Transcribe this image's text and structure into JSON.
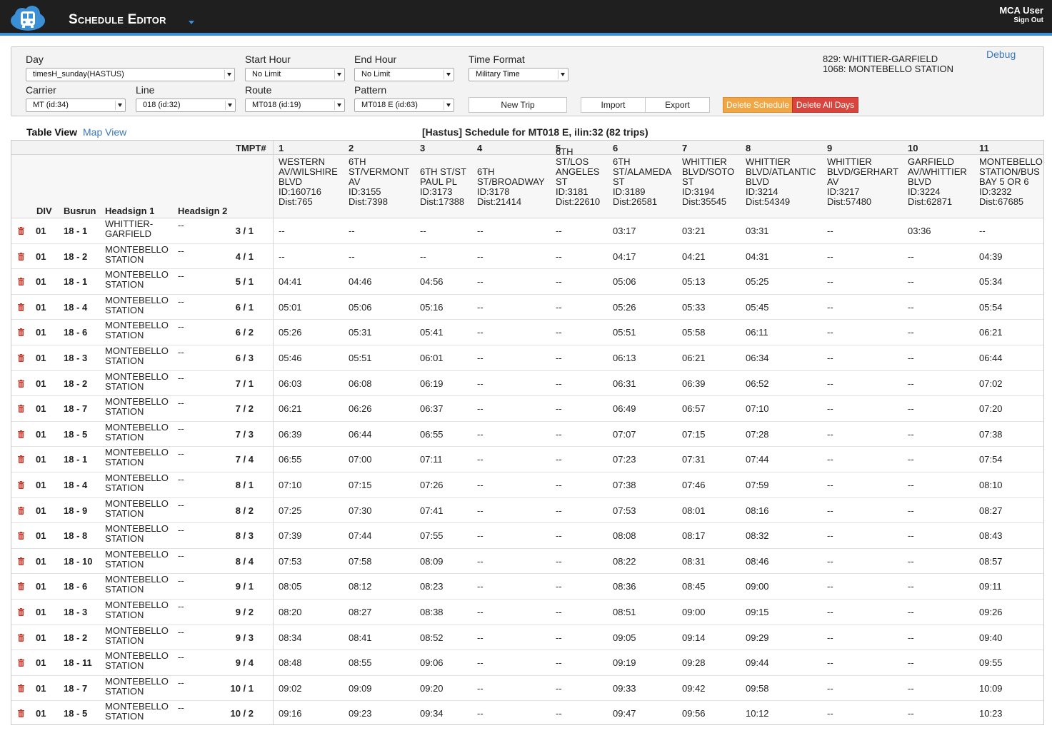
{
  "header": {
    "title": "Schedule Editor",
    "user": "MCA User",
    "sign_out": "Sign Out",
    "logo_icon": "bus-cloud-icon",
    "accent_color": "#3b8fd6"
  },
  "controls": {
    "day_label": "Day",
    "day_value": "timesH_sunday(HASTUS)",
    "start_hour_label": "Start Hour",
    "start_hour_value": "No Limit",
    "end_hour_label": "End Hour",
    "end_hour_value": "No Limit",
    "time_format_label": "Time Format",
    "time_format_value": "Military Time",
    "carrier_label": "Carrier",
    "carrier_value": "MT (id:34)",
    "line_label": "Line",
    "line_value": "018 (id:32)",
    "route_label": "Route",
    "route_value": "MT018 (id:19)",
    "pattern_label": "Pattern",
    "pattern_value": "MT018 E (id:63)",
    "new_trip": "New Trip",
    "import": "Import",
    "export": "Export",
    "delete_schedule": "Delete Schedule",
    "delete_all_days": "Delete All Days",
    "info_line1": "829: WHITTIER-GARFIELD",
    "info_line2": "1068: MONTEBELLO STATION",
    "debug": "Debug"
  },
  "view": {
    "table_view": "Table View",
    "map_view": "Map View",
    "schedule_title": "[Hastus] Schedule for MT018 E, ilin:32 (82 trips)"
  },
  "table": {
    "tmpt_label": "TMPT#",
    "col_div": "DIV",
    "col_busrun": "Busrun",
    "col_headsign1": "Headsign 1",
    "col_headsign2": "Headsign 2",
    "stop_numbers": [
      "1",
      "2",
      "3",
      "4",
      "5",
      "6",
      "7",
      "8",
      "9",
      "10",
      "11"
    ],
    "stops": [
      "WESTERN\nAV/WILSHIRE\nBLVD\nID:160716\nDist:765",
      "6TH\nST/VERMONT\nAV\nID:3155\nDist:7398",
      "6TH ST/ST\nPAUL PL\nID:3173\nDist:17388",
      "6TH\nST/BROADWAY\nID:3178\nDist:21414",
      "6TH\nST/LOS\nANGELES\nST\nID:3181\nDist:22610",
      "6TH\nST/ALAMEDA\nST\nID:3189\nDist:26581",
      "WHITTIER\nBLVD/SOTO\nST\nID:3194\nDist:35545",
      "WHITTIER\nBLVD/ATLANTIC\nBLVD\nID:3214\nDist:54349",
      "WHITTIER\nBLVD/GERHART\nAV\nID:3217\nDist:57480",
      "GARFIELD\nAV/WHITTIER\nBLVD\nID:3224\nDist:62871",
      "MONTEBELLO\nSTATION/BUS\nBAY 5 OR 6\nID:3232\nDist:67685"
    ],
    "rows": [
      {
        "div": "01",
        "busrun": "18 - 1",
        "h1": "WHITTIER-\nGARFIELD",
        "h2": "--",
        "tmpt": "3 / 1",
        "times": [
          "--",
          "--",
          "--",
          "--",
          "--",
          "03:17",
          "03:21",
          "03:31",
          "--",
          "03:36",
          "--"
        ]
      },
      {
        "div": "01",
        "busrun": "18 - 2",
        "h1": "MONTEBELLO\nSTATION",
        "h2": "--",
        "tmpt": "4 / 1",
        "times": [
          "--",
          "--",
          "--",
          "--",
          "--",
          "04:17",
          "04:21",
          "04:31",
          "--",
          "--",
          "04:39"
        ]
      },
      {
        "div": "01",
        "busrun": "18 - 1",
        "h1": "MONTEBELLO\nSTATION",
        "h2": "--",
        "tmpt": "5 / 1",
        "times": [
          "04:41",
          "04:46",
          "04:56",
          "--",
          "--",
          "05:06",
          "05:13",
          "05:25",
          "--",
          "--",
          "05:34"
        ]
      },
      {
        "div": "01",
        "busrun": "18 - 4",
        "h1": "MONTEBELLO\nSTATION",
        "h2": "--",
        "tmpt": "6 / 1",
        "times": [
          "05:01",
          "05:06",
          "05:16",
          "--",
          "--",
          "05:26",
          "05:33",
          "05:45",
          "--",
          "--",
          "05:54"
        ]
      },
      {
        "div": "01",
        "busrun": "18 - 6",
        "h1": "MONTEBELLO\nSTATION",
        "h2": "--",
        "tmpt": "6 / 2",
        "times": [
          "05:26",
          "05:31",
          "05:41",
          "--",
          "--",
          "05:51",
          "05:58",
          "06:11",
          "--",
          "--",
          "06:21"
        ]
      },
      {
        "div": "01",
        "busrun": "18 - 3",
        "h1": "MONTEBELLO\nSTATION",
        "h2": "--",
        "tmpt": "6 / 3",
        "times": [
          "05:46",
          "05:51",
          "06:01",
          "--",
          "--",
          "06:13",
          "06:21",
          "06:34",
          "--",
          "--",
          "06:44"
        ]
      },
      {
        "div": "01",
        "busrun": "18 - 2",
        "h1": "MONTEBELLO\nSTATION",
        "h2": "--",
        "tmpt": "7 / 1",
        "times": [
          "06:03",
          "06:08",
          "06:19",
          "--",
          "--",
          "06:31",
          "06:39",
          "06:52",
          "--",
          "--",
          "07:02"
        ]
      },
      {
        "div": "01",
        "busrun": "18 - 7",
        "h1": "MONTEBELLO\nSTATION",
        "h2": "--",
        "tmpt": "7 / 2",
        "times": [
          "06:21",
          "06:26",
          "06:37",
          "--",
          "--",
          "06:49",
          "06:57",
          "07:10",
          "--",
          "--",
          "07:20"
        ]
      },
      {
        "div": "01",
        "busrun": "18 - 5",
        "h1": "MONTEBELLO\nSTATION",
        "h2": "--",
        "tmpt": "7 / 3",
        "times": [
          "06:39",
          "06:44",
          "06:55",
          "--",
          "--",
          "07:07",
          "07:15",
          "07:28",
          "--",
          "--",
          "07:38"
        ]
      },
      {
        "div": "01",
        "busrun": "18 - 1",
        "h1": "MONTEBELLO\nSTATION",
        "h2": "--",
        "tmpt": "7 / 4",
        "times": [
          "06:55",
          "07:00",
          "07:11",
          "--",
          "--",
          "07:23",
          "07:31",
          "07:44",
          "--",
          "--",
          "07:54"
        ]
      },
      {
        "div": "01",
        "busrun": "18 - 4",
        "h1": "MONTEBELLO\nSTATION",
        "h2": "--",
        "tmpt": "8 / 1",
        "times": [
          "07:10",
          "07:15",
          "07:26",
          "--",
          "--",
          "07:38",
          "07:46",
          "07:59",
          "--",
          "--",
          "08:10"
        ]
      },
      {
        "div": "01",
        "busrun": "18 - 9",
        "h1": "MONTEBELLO\nSTATION",
        "h2": "--",
        "tmpt": "8 / 2",
        "times": [
          "07:25",
          "07:30",
          "07:41",
          "--",
          "--",
          "07:53",
          "08:01",
          "08:16",
          "--",
          "--",
          "08:27"
        ]
      },
      {
        "div": "01",
        "busrun": "18 - 8",
        "h1": "MONTEBELLO\nSTATION",
        "h2": "--",
        "tmpt": "8 / 3",
        "times": [
          "07:39",
          "07:44",
          "07:55",
          "--",
          "--",
          "08:08",
          "08:17",
          "08:32",
          "--",
          "--",
          "08:43"
        ]
      },
      {
        "div": "01",
        "busrun": "18 - 10",
        "h1": "MONTEBELLO\nSTATION",
        "h2": "--",
        "tmpt": "8 / 4",
        "times": [
          "07:53",
          "07:58",
          "08:09",
          "--",
          "--",
          "08:22",
          "08:31",
          "08:46",
          "--",
          "--",
          "08:57"
        ]
      },
      {
        "div": "01",
        "busrun": "18 - 6",
        "h1": "MONTEBELLO\nSTATION",
        "h2": "--",
        "tmpt": "9 / 1",
        "times": [
          "08:05",
          "08:12",
          "08:23",
          "--",
          "--",
          "08:36",
          "08:45",
          "09:00",
          "--",
          "--",
          "09:11"
        ]
      },
      {
        "div": "01",
        "busrun": "18 - 3",
        "h1": "MONTEBELLO\nSTATION",
        "h2": "--",
        "tmpt": "9 / 2",
        "times": [
          "08:20",
          "08:27",
          "08:38",
          "--",
          "--",
          "08:51",
          "09:00",
          "09:15",
          "--",
          "--",
          "09:26"
        ]
      },
      {
        "div": "01",
        "busrun": "18 - 2",
        "h1": "MONTEBELLO\nSTATION",
        "h2": "--",
        "tmpt": "9 / 3",
        "times": [
          "08:34",
          "08:41",
          "08:52",
          "--",
          "--",
          "09:05",
          "09:14",
          "09:29",
          "--",
          "--",
          "09:40"
        ]
      },
      {
        "div": "01",
        "busrun": "18 - 11",
        "h1": "MONTEBELLO\nSTATION",
        "h2": "--",
        "tmpt": "9 / 4",
        "times": [
          "08:48",
          "08:55",
          "09:06",
          "--",
          "--",
          "09:19",
          "09:28",
          "09:44",
          "--",
          "--",
          "09:55"
        ]
      },
      {
        "div": "01",
        "busrun": "18 - 7",
        "h1": "MONTEBELLO\nSTATION",
        "h2": "--",
        "tmpt": "10 / 1",
        "times": [
          "09:02",
          "09:09",
          "09:20",
          "--",
          "--",
          "09:33",
          "09:42",
          "09:58",
          "--",
          "--",
          "10:09"
        ]
      },
      {
        "div": "01",
        "busrun": "18 - 5",
        "h1": "MONTEBELLO\nSTATION",
        "h2": "--",
        "tmpt": "10 / 2",
        "times": [
          "09:16",
          "09:23",
          "09:34",
          "--",
          "--",
          "09:47",
          "09:56",
          "10:12",
          "--",
          "--",
          "10:23"
        ]
      }
    ]
  }
}
